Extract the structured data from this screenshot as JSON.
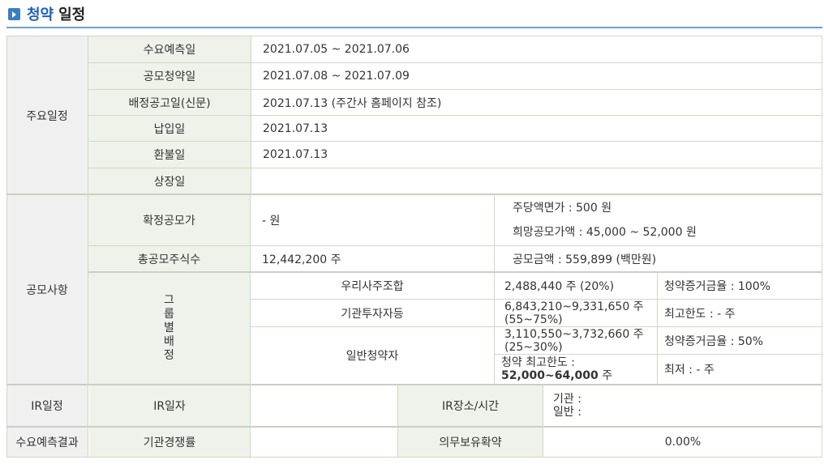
{
  "title": {
    "part1": "청약",
    "part2": "일정"
  },
  "schedule": {
    "section_label": "주요일정",
    "rows": [
      {
        "label": "수요예측일",
        "value": "2021.07.05  ~   2021.07.06"
      },
      {
        "label": "공모청약일",
        "value": "2021.07.08  ~   2021.07.09"
      },
      {
        "label": "배정공고일(신문)",
        "value": "2021.07.13 (주간사 홈페이지 참조)"
      },
      {
        "label": "납입일",
        "value": "2021.07.13"
      },
      {
        "label": "환불일",
        "value": "2021.07.13"
      },
      {
        "label": "상장일",
        "value": ""
      }
    ]
  },
  "offering": {
    "section_label": "공모사항",
    "final_price_label": "확정공모가",
    "final_price_value": "- 원",
    "par_value": "주당액면가 :  500 원",
    "desired_price": "희망공모가액 :  45,000 ~ 52,000 원",
    "total_shares_label": "총공모주식수",
    "total_shares_value": "12,442,200 주",
    "total_amount": "공모금액 : 559,899 (백만원)",
    "group_label_chars": [
      "그",
      "룹",
      "별",
      "배",
      "정"
    ],
    "groups": {
      "employee": {
        "name": "우리사주조합",
        "shares": "2,488,440 주  (20%)",
        "note": "청약증거금율 : 100%"
      },
      "institution": {
        "name": "기관투자자등",
        "shares_line1": "6,843,210~9,331,650 주",
        "shares_line2": "(55~75%)",
        "note": "최고한도 :  - 주"
      },
      "general": {
        "name": "일반청약자",
        "shares_line1": "3,110,550~3,732,660 주",
        "shares_line2": "(25~30%)",
        "note": "청약증거금율 : 50%",
        "max_label": "청약 최고한도 :",
        "max_value": "52,000~64,000",
        "max_unit": " 주",
        "min_note": "최저 :  - 주"
      }
    }
  },
  "ir": {
    "section_label": "IR일정",
    "date_label": "IR일자",
    "date_value": "",
    "place_label": "IR장소/시간",
    "place_line1": "기관 :",
    "place_line2": "일반 :"
  },
  "demand": {
    "section_label": "수요예측결과",
    "competition_label": "기관경쟁률",
    "competition_value": "",
    "lockup_label": "의무보유확약",
    "lockup_value": "0.00%"
  }
}
